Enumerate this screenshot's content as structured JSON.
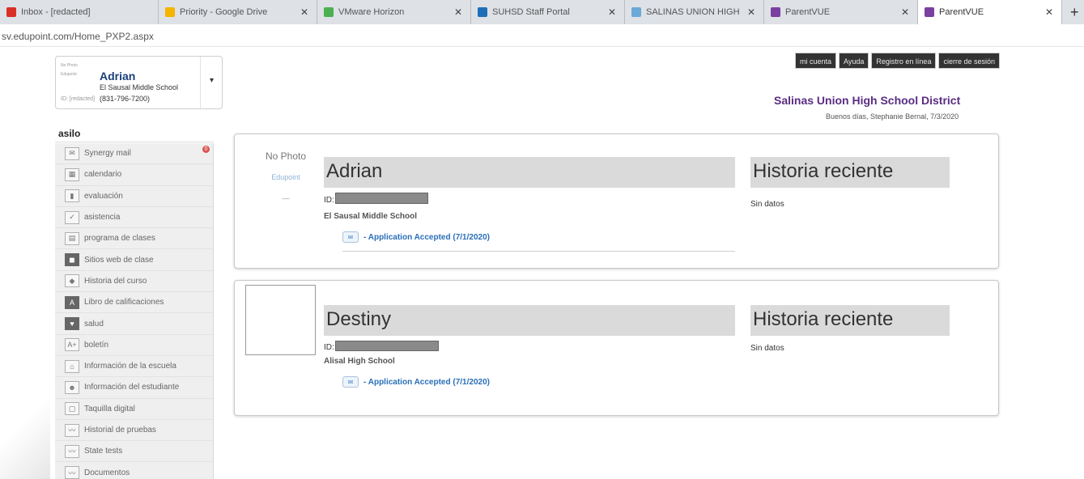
{
  "browser": {
    "tabs": [
      {
        "title": "Inbox - [redacted]",
        "color": "#d93025",
        "active": false
      },
      {
        "title": "Priority - Google Drive",
        "color": "#f4b400",
        "active": false
      },
      {
        "title": "VMware Horizon",
        "color": "#4caf50",
        "active": false
      },
      {
        "title": "SUHSD Staff Portal",
        "color": "#1e6fb8",
        "active": false
      },
      {
        "title": "SALINAS UNION HIGH SCH",
        "color": "#6aa9d8",
        "active": false
      },
      {
        "title": "ParentVUE",
        "color": "#7b3fa0",
        "active": false
      },
      {
        "title": "ParentVUE",
        "color": "#7b3fa0",
        "active": true
      }
    ],
    "url": "sv.edupoint.com/Home_PXP2.aspx"
  },
  "student_card": {
    "photo_text": "No Photo",
    "photo_sub": "Edupoint",
    "name": "Adrian",
    "school": "El Sausal Middle School",
    "id_text": "ID: [redacted]",
    "phone": "(831-796-7200)"
  },
  "top_buttons": [
    "mi cuenta",
    "Ayuda",
    "Registro en línea",
    "cierre de sesión"
  ],
  "district": "Salinas Union High School District",
  "greeting": "Buenos días, Stephanie Bernal, 7/3/2020",
  "sidebar": {
    "header": "asilo",
    "items": [
      {
        "label": "Synergy mail",
        "icon": "mail-icon",
        "glyph": "✉",
        "badge": "0"
      },
      {
        "label": "calendario",
        "icon": "calendar-icon",
        "glyph": "▦"
      },
      {
        "label": "evaluación",
        "icon": "bar-chart-icon",
        "glyph": "▮"
      },
      {
        "label": "asistencia",
        "icon": "checkbox-icon",
        "glyph": "✓"
      },
      {
        "label": "programa de clases",
        "icon": "schedule-icon",
        "glyph": "▤"
      },
      {
        "label": "Sitios web de clase",
        "icon": "web-icon",
        "glyph": "◼",
        "dark": true
      },
      {
        "label": "Historia del curso",
        "icon": "course-history-icon",
        "glyph": "◆"
      },
      {
        "label": "Libro de calificaciones",
        "icon": "gradebook-icon",
        "glyph": "A",
        "dark": true
      },
      {
        "label": "salud",
        "icon": "health-icon",
        "glyph": "♥",
        "dark": true
      },
      {
        "label": "boletín",
        "icon": "report-card-icon",
        "glyph": "A+"
      },
      {
        "label": "Información de la escuela",
        "icon": "school-icon",
        "glyph": "⌂"
      },
      {
        "label": "Información del estudiante",
        "icon": "student-icon",
        "glyph": "☻"
      },
      {
        "label": "Taquilla digital",
        "icon": "locker-icon",
        "glyph": "▢"
      },
      {
        "label": "Historial de pruebas",
        "icon": "test-history-icon",
        "glyph": "〰"
      },
      {
        "label": "State tests",
        "icon": "state-tests-icon",
        "glyph": "〰"
      },
      {
        "label": "Documentos",
        "icon": "documents-icon",
        "glyph": "〰"
      }
    ]
  },
  "students": [
    {
      "name": "Adrian",
      "photo_text": "No Photo",
      "photo_sub": "Edupoint",
      "photo_dash": "—",
      "id_label": "ID:",
      "school": "El Sausal Middle School",
      "application": "- Application Accepted (7/1/2020)",
      "history_title": "Historia reciente",
      "history_text": "Sin datos"
    },
    {
      "name": "Destiny",
      "id_label": "ID:",
      "school": "Alisal High School",
      "application": "- Application Accepted (7/1/2020)",
      "history_title": "Historia reciente",
      "history_text": "Sin datos"
    }
  ]
}
